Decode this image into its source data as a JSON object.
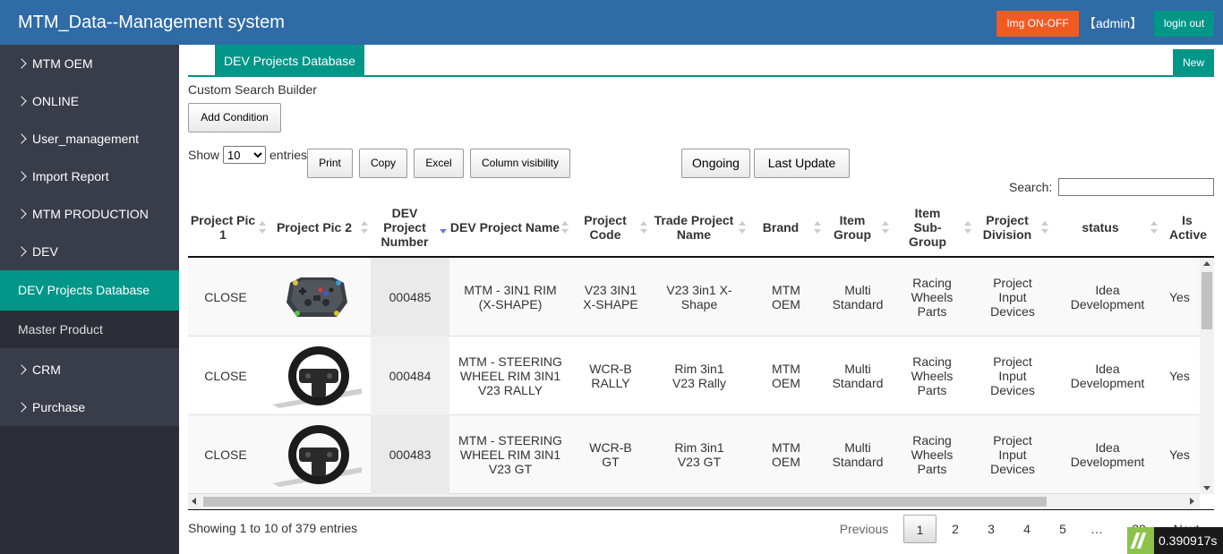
{
  "header": {
    "title": "MTM_Data--Management system",
    "img_toggle_label": "Img ON-OFF",
    "user_label": "【admin】",
    "logout_label": "login out"
  },
  "sidebar": {
    "items": [
      {
        "label": "MTM OEM"
      },
      {
        "label": "ONLINE"
      },
      {
        "label": "User_management"
      },
      {
        "label": "Import Report"
      },
      {
        "label": "MTM PRODUCTION"
      },
      {
        "label": "DEV"
      },
      {
        "label": "DEV Projects Database",
        "active": true
      },
      {
        "label": "Master Product"
      },
      {
        "label": "CRM"
      },
      {
        "label": "Purchase"
      }
    ]
  },
  "tabs": {
    "active_label": "DEV Projects Database",
    "new_label": "New"
  },
  "search_builder": {
    "title": "Custom Search Builder",
    "add_condition_label": "Add Condition"
  },
  "controls": {
    "show_label": "Show",
    "length_value": "10",
    "entries_label": "entries",
    "buttons": {
      "print": "Print",
      "copy": "Copy",
      "excel": "Excel",
      "column_visibility": "Column visibility",
      "ongoing": "Ongoing",
      "last_update": "Last Update"
    },
    "search_label": "Search:",
    "search_value": ""
  },
  "table": {
    "columns": [
      "Project Pic 1",
      "Project Pic 2",
      "DEV Project Number",
      "DEV Project Name",
      "Project Code",
      "Trade Project Name",
      "Brand",
      "Item Group",
      "Item Sub-Group",
      "Project Division",
      "status",
      "Is Active"
    ],
    "rows": [
      {
        "pic1": "CLOSE",
        "pic2_icon": "button-box-image",
        "number": "000485",
        "name": "MTM - 3IN1 RIM (X-SHAPE)",
        "code": "V23 3IN1 X-SHAPE",
        "trade_name": "V23 3in1 X-Shape",
        "brand": "MTM OEM",
        "item_group": "Multi Standard",
        "sub_group": "Racing Wheels Parts",
        "division": "Project Input Devices",
        "status": "Idea Development",
        "active": "Yes"
      },
      {
        "pic1": "CLOSE",
        "pic2_icon": "steering-wheel-image",
        "number": "000484",
        "name": "MTM - STEERING WHEEL RIM 3IN1 V23 RALLY",
        "code": "WCR-B RALLY",
        "trade_name": "Rim 3in1 V23 Rally",
        "brand": "MTM OEM",
        "item_group": "Multi Standard",
        "sub_group": "Racing Wheels Parts",
        "division": "Project Input Devices",
        "status": "Idea Development",
        "active": "Yes"
      },
      {
        "pic1": "CLOSE",
        "pic2_icon": "steering-wheel-image",
        "number": "000483",
        "name": "MTM - STEERING WHEEL RIM 3IN1 V23 GT",
        "code": "WCR-B GT",
        "trade_name": "Rim 3in1 V23 GT",
        "brand": "MTM OEM",
        "item_group": "Multi Standard",
        "sub_group": "Racing Wheels Parts",
        "division": "Project Input Devices",
        "status": "Idea Development",
        "active": "Yes"
      }
    ]
  },
  "footer": {
    "info": "Showing 1 to 10 of 379 entries",
    "pagination": {
      "previous": "Previous",
      "pages": [
        "1",
        "2",
        "3",
        "4",
        "5"
      ],
      "ellipsis": "…",
      "last_page": "38",
      "next": "Next",
      "current": "1"
    }
  },
  "perf_badge": {
    "value": "0.390917s"
  }
}
